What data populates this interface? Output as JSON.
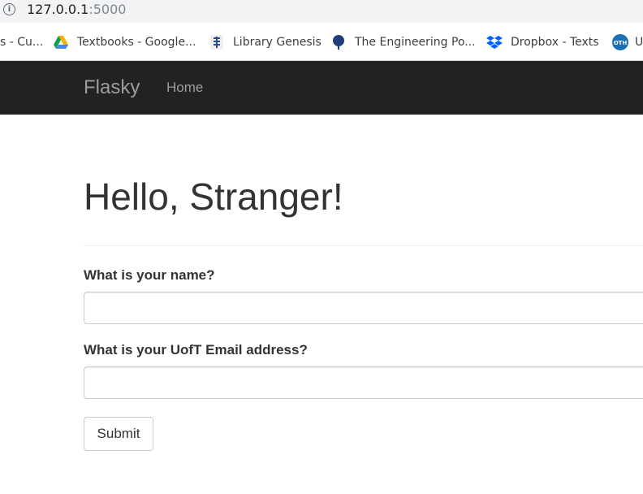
{
  "browser": {
    "url_host": "127.0.0.1",
    "url_port": ":5000",
    "info_icon": "i",
    "bookmarks": [
      {
        "label": "s - Cu...",
        "icon": "none"
      },
      {
        "label": "Textbooks - Google...",
        "icon": "google-drive-icon"
      },
      {
        "label": "Library Genesis",
        "icon": "library-genesis-icon"
      },
      {
        "label": "The Engineering Po...",
        "icon": "tree-icon"
      },
      {
        "label": "Dropbox - Texts",
        "icon": "dropbox-icon"
      },
      {
        "label": "OTH",
        "icon": "oth-badge-icon"
      },
      {
        "label": "U",
        "icon": "none"
      }
    ]
  },
  "navbar": {
    "brand": "Flasky",
    "home": "Home"
  },
  "main": {
    "title": "Hello, Stranger!",
    "name_label": "What is your name?",
    "name_value": "",
    "email_label": "What is your UofT Email address?",
    "email_value": "",
    "submit_label": "Submit"
  },
  "colors": {
    "navbar_bg": "#222222",
    "navbar_text": "#9d9d9d",
    "text": "#333333",
    "drive_green": "#0f9d58",
    "drive_yellow": "#f4b400",
    "drive_blue": "#4285f4",
    "dropbox_blue": "#0061ff",
    "oth_blue": "#1a6fb5"
  }
}
